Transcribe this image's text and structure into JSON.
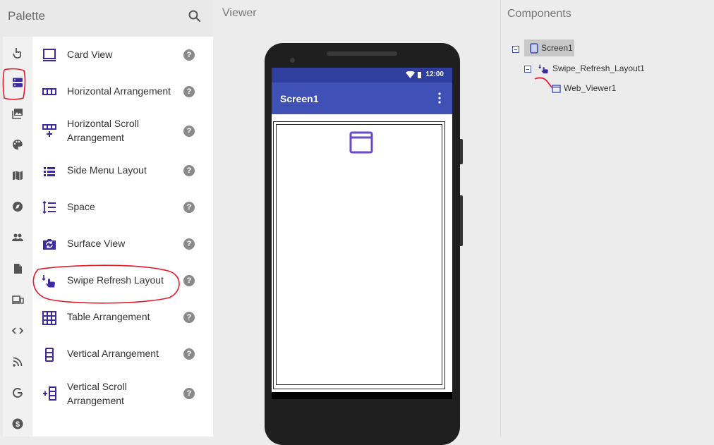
{
  "palette": {
    "title": "Palette",
    "categories": [
      {
        "icon": "touch-icon"
      },
      {
        "icon": "layout-icon",
        "selected": true
      },
      {
        "icon": "media-icon"
      },
      {
        "icon": "palette-icon"
      },
      {
        "icon": "map-icon"
      },
      {
        "icon": "compass-icon"
      },
      {
        "icon": "people-icon"
      },
      {
        "icon": "document-icon"
      },
      {
        "icon": "devices-icon"
      },
      {
        "icon": "code-icon"
      },
      {
        "icon": "rss-icon"
      },
      {
        "icon": "google-icon"
      },
      {
        "icon": "dollar-icon"
      }
    ],
    "components": [
      {
        "label": "Card View",
        "icon": "card-view-icon"
      },
      {
        "label": "Horizontal Arrangement",
        "icon": "horizontal-arrangement-icon"
      },
      {
        "label": "Horizontal Scroll Arrangement",
        "icon": "horizontal-scroll-arrangement-icon"
      },
      {
        "label": "Side Menu Layout",
        "icon": "side-menu-layout-icon"
      },
      {
        "label": "Space",
        "icon": "space-icon"
      },
      {
        "label": "Surface View",
        "icon": "surface-view-icon"
      },
      {
        "label": "Swipe Refresh Layout",
        "icon": "swipe-refresh-layout-icon",
        "highlighted": true
      },
      {
        "label": "Table Arrangement",
        "icon": "table-arrangement-icon"
      },
      {
        "label": "Vertical Arrangement",
        "icon": "vertical-arrangement-icon"
      },
      {
        "label": "Vertical Scroll Arrangement",
        "icon": "vertical-scroll-arrangement-icon"
      }
    ],
    "help_glyph": "?"
  },
  "viewer": {
    "title": "Viewer",
    "phone": {
      "status_time": "12:00",
      "screen_title": "Screen1"
    }
  },
  "components": {
    "title": "Components",
    "tree": [
      {
        "label": "Screen1",
        "level": 0,
        "selected": true
      },
      {
        "label": "Swipe_Refresh_Layout1",
        "level": 1
      },
      {
        "label": "Web_Viewer1",
        "level": 2
      }
    ]
  },
  "colors": {
    "accent": "#3f51b5",
    "status_bar": "#303f9f",
    "icon_purple": "#3b2aa0",
    "annotation_red": "#e8182c"
  }
}
